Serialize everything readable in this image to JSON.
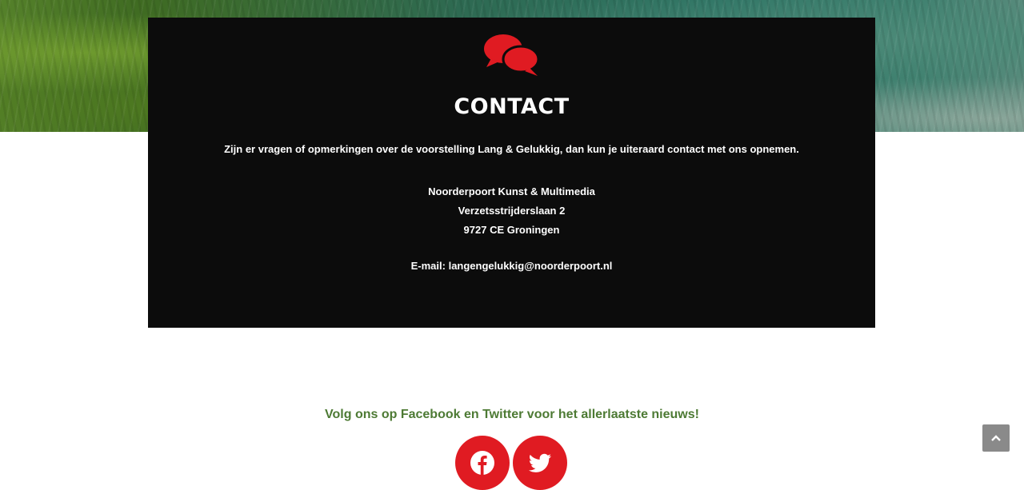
{
  "contact": {
    "icon": "chat-bubbles-icon",
    "icon_color": "#e01b22",
    "title": "CONTACT",
    "intro": "Zijn er vragen of opmerkingen over de voorstelling Lang & Gelukkig, dan kun je uiteraard contact met ons opnemen.",
    "address": {
      "name": "Noorderpoort Kunst & Multimedia",
      "street": "Verzetsstrijderslaan 2",
      "city": "9727 CE Groningen"
    },
    "email_line": "E-mail: langengelukkig@noorderpoort.nl",
    "background": "#0c0c0c"
  },
  "social": {
    "follow_text": "Volg ons op Facebook en Twitter voor het allerlaatste nieuws!",
    "follow_color": "#4d7a34",
    "buttons": [
      {
        "name": "facebook",
        "icon": "facebook-icon"
      },
      {
        "name": "twitter",
        "icon": "twitter-icon"
      }
    ],
    "button_color": "#e01b22"
  },
  "scroll_top": {
    "icon": "chevron-up-icon"
  }
}
